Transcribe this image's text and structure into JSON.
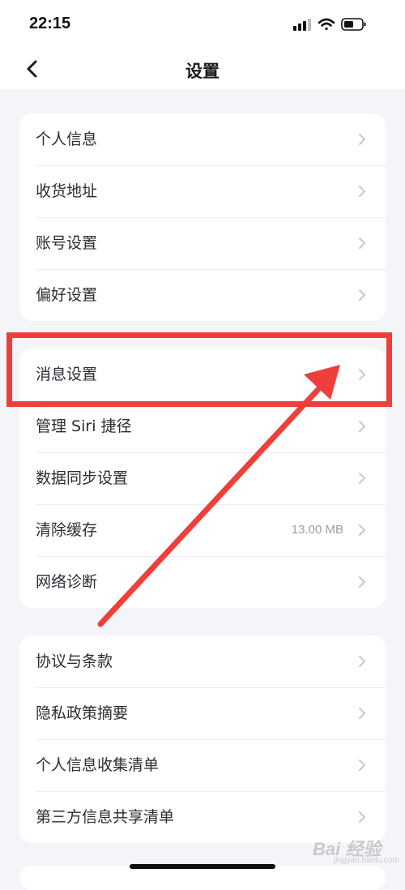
{
  "status_bar": {
    "time": "22:15"
  },
  "nav": {
    "title": "设置"
  },
  "group1": [
    {
      "label": "个人信息"
    },
    {
      "label": "收货地址"
    },
    {
      "label": "账号设置"
    },
    {
      "label": "偏好设置"
    }
  ],
  "group2": [
    {
      "label": "消息设置"
    },
    {
      "label": "管理 Siri 捷径"
    },
    {
      "label": "数据同步设置"
    },
    {
      "label": "清除缓存",
      "value": "13.00 MB"
    },
    {
      "label": "网络诊断"
    }
  ],
  "group3": [
    {
      "label": "协议与条款"
    },
    {
      "label": "隐私政策摘要"
    },
    {
      "label": "个人信息收集清单"
    },
    {
      "label": "第三方信息共享清单"
    }
  ],
  "annotation": {
    "color": "#ee3f3a"
  },
  "watermark": {
    "text": "Bai 经验",
    "sub": "jingyan.baidu.com"
  }
}
